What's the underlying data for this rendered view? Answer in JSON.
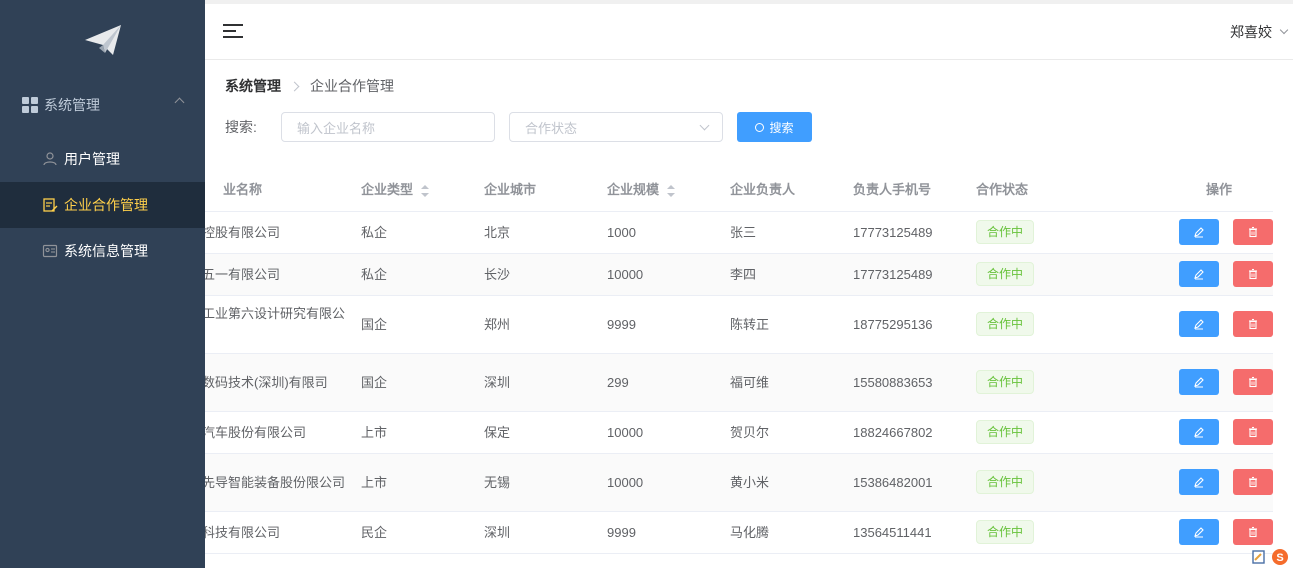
{
  "sidebar": {
    "group_label": "系统管理",
    "items": [
      {
        "label": "用户管理",
        "icon": "users-icon",
        "active": false
      },
      {
        "label": "企业合作管理",
        "icon": "edit-doc-icon",
        "active": true
      },
      {
        "label": "系统信息管理",
        "icon": "id-card-icon",
        "active": false
      }
    ]
  },
  "header": {
    "user_name": "郑喜姣"
  },
  "breadcrumb": {
    "root": "系统管理",
    "current": "企业合作管理"
  },
  "search": {
    "label": "搜索:",
    "name_placeholder": "输入企业名称",
    "status_placeholder": "合作状态",
    "button_label": "搜索"
  },
  "table": {
    "columns": [
      "业名称",
      "企业类型",
      "企业城市",
      "企业规模",
      "企业负责人",
      "负责人手机号",
      "合作状态",
      "操作"
    ],
    "rows": [
      {
        "name": "京控股有限公司",
        "type": "私企",
        "city": "北京",
        "scale": "1000",
        "leader": "张三",
        "phone": "17773125489",
        "status": "合作中"
      },
      {
        "name": "沙五一有限公司",
        "type": "私企",
        "city": "长沙",
        "scale": "10000",
        "leader": "李四",
        "phone": "17773125489",
        "status": "合作中"
      },
      {
        "name": "械工业第六设计研究有限公司",
        "type": "国企",
        "city": "郑州",
        "scale": "9999",
        "leader": "陈转正",
        "phone": "18775295136",
        "status": "合作中"
      },
      {
        "name": "星数码技术(深圳)有限司",
        "type": "国企",
        "city": "深圳",
        "scale": "299",
        "leader": "福可维",
        "phone": "15580883653",
        "status": "合作中"
      },
      {
        "name": "威汽车股份有限公司",
        "type": "上市",
        "city": "保定",
        "scale": "10000",
        "leader": "贺贝尔",
        "phone": "18824667802",
        "status": "合作中"
      },
      {
        "name": "锡先导智能装备股份限公司",
        "type": "上市",
        "city": "无锡",
        "scale": "10000",
        "leader": "黄小米",
        "phone": "15386482001",
        "status": "合作中"
      },
      {
        "name": "讯科技有限公司",
        "type": "民企",
        "city": "深圳",
        "scale": "9999",
        "leader": "马化腾",
        "phone": "13564511441",
        "status": "合作中"
      }
    ]
  },
  "colors": {
    "sidebar_bg": "#304156",
    "active_text": "#ffd04b",
    "primary": "#409eff",
    "danger": "#f56c6c",
    "success": "#67c23a"
  }
}
